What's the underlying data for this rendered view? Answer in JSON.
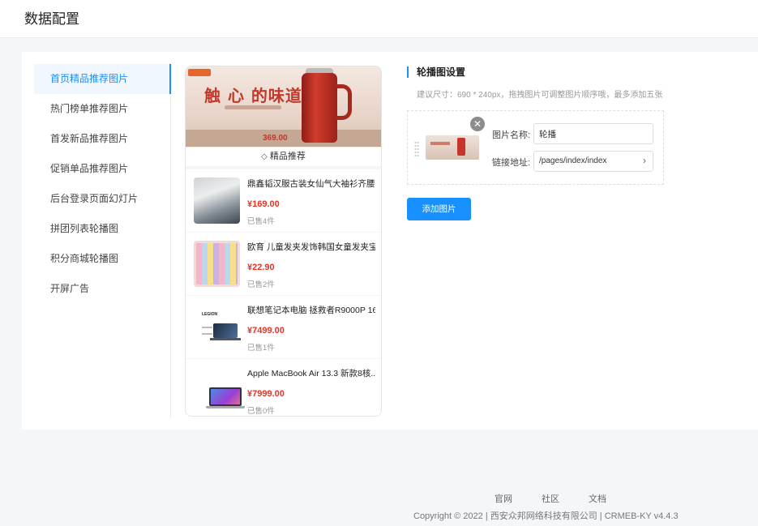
{
  "header": {
    "title": "数据配置"
  },
  "sidebar": {
    "items": [
      {
        "label": "首页精品推荐图片",
        "active": true
      },
      {
        "label": "热门榜单推荐图片",
        "active": false
      },
      {
        "label": "首发新品推荐图片",
        "active": false
      },
      {
        "label": "促销单品推荐图片",
        "active": false
      },
      {
        "label": "后台登录页面幻灯片",
        "active": false
      },
      {
        "label": "拼团列表轮播图",
        "active": false
      },
      {
        "label": "积分商城轮播图",
        "active": false
      },
      {
        "label": "开屏广告",
        "active": false
      }
    ]
  },
  "preview": {
    "banner": {
      "slogan": "触 心 的味道",
      "price": "369.00"
    },
    "section_title": "精品推荐",
    "products": [
      {
        "name": "鼎鑫韬汉服古装女仙气大袖衫齐腰...",
        "price": "¥169.00",
        "sold": "已售4件",
        "image": "dress"
      },
      {
        "name": "欧育 儿童发夹发饰韩国女童发夹宝...",
        "price": "¥22.90",
        "sold": "已售2件",
        "image": "hair-clips"
      },
      {
        "name": "联想笔记本电脑 拯救者R9000P 16...",
        "price": "¥7499.00",
        "sold": "已售1件",
        "image": "lenovo-laptop",
        "brand": "LEGION"
      },
      {
        "name": "Apple MacBook Air 13.3 新款8核...",
        "price": "¥7999.00",
        "sold": "已售0件",
        "image": "macbook"
      }
    ]
  },
  "settings": {
    "title": "轮播图设置",
    "tip": "建议尺寸：690 * 240px，拖拽图片可调整图片顺序哦，最多添加五张",
    "item": {
      "name_label": "图片名称:",
      "name_value": "轮播",
      "link_label": "链接地址:",
      "link_value": "/pages/index/index"
    },
    "add_button": "添加图片"
  },
  "footer": {
    "links": [
      "官网",
      "社区",
      "文档"
    ],
    "copyright": "Copyright © 2022 | 西安众邦网络科技有限公司 | CRMEB-KY v4.4.3"
  },
  "colors": {
    "accent": "#1890ff",
    "price": "#e93323"
  },
  "icons": {
    "remove": "close-circle-icon",
    "drag": "drag-handle-icon",
    "chevron": "chevron-right-icon",
    "section": "diamond-icon"
  }
}
